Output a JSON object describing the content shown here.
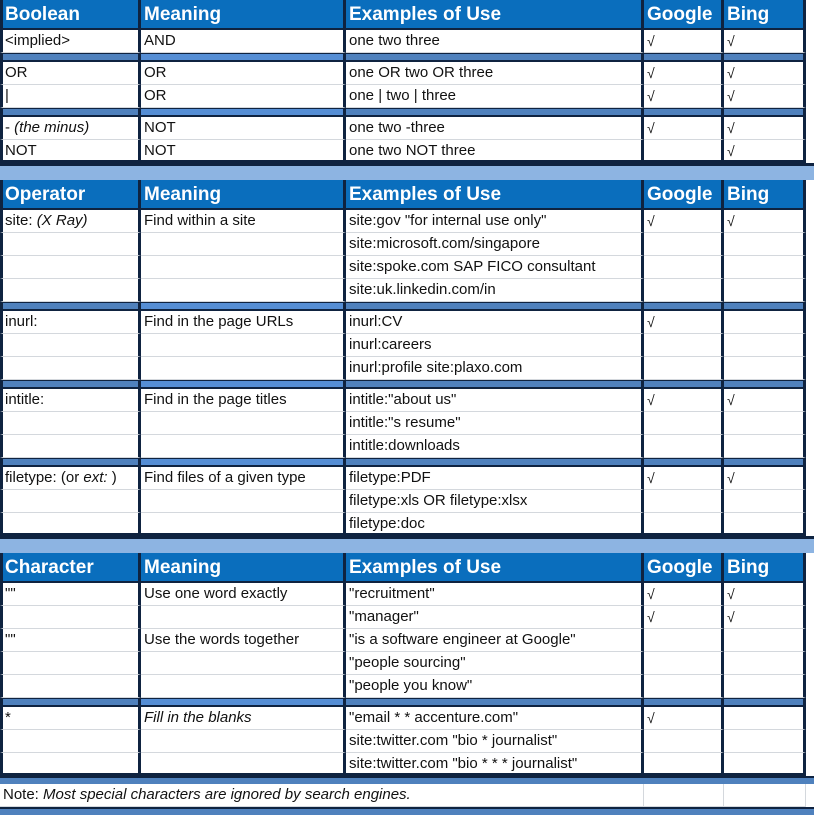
{
  "sections": [
    {
      "id": "boolean",
      "headers": [
        "Boolean",
        "Meaning",
        "Examples of Use",
        "Google",
        "Bing"
      ],
      "groups": [
        {
          "rows": [
            {
              "op": "<implied>",
              "meaning": "AND",
              "example": "one two three",
              "google": "√",
              "bing": "√"
            }
          ]
        },
        {
          "rows": [
            {
              "op": "OR",
              "meaning": "OR",
              "example": "one OR two OR three",
              "google": "√",
              "bing": "√"
            },
            {
              "op": "|",
              "meaning": "OR",
              "example": "one | two | three",
              "google": "√",
              "bing": "√"
            }
          ]
        },
        {
          "rows": [
            {
              "op": " - ",
              "op_italic": "(the minus)",
              "meaning": "NOT",
              "example": "one two -three",
              "google": "√",
              "bing": "√"
            },
            {
              "op": "NOT",
              "meaning": "NOT",
              "example": "one two NOT three",
              "google": "",
              "bing": "√"
            }
          ]
        }
      ]
    },
    {
      "id": "operator",
      "headers": [
        "Operator",
        "Meaning",
        "Examples of Use",
        "Google",
        "Bing"
      ],
      "groups": [
        {
          "rows": [
            {
              "op": "site: ",
              "op_italic": "(X Ray)",
              "meaning": "Find within a site",
              "example": "site:gov \"for internal use only\"",
              "google": "√",
              "bing": "√"
            },
            {
              "op": "",
              "meaning": "",
              "example": "site:microsoft.com/singapore",
              "google": "",
              "bing": ""
            },
            {
              "op": "",
              "meaning": "",
              "example": "site:spoke.com SAP FICO consultant",
              "google": "",
              "bing": ""
            },
            {
              "op": "",
              "meaning": "",
              "example": "site:uk.linkedin.com/in",
              "google": "",
              "bing": ""
            }
          ]
        },
        {
          "rows": [
            {
              "op": "inurl:",
              "meaning": "Find in the page URLs",
              "example": "inurl:CV",
              "google": "√",
              "bing": ""
            },
            {
              "op": "",
              "meaning": "",
              "example": "inurl:careers",
              "google": "",
              "bing": ""
            },
            {
              "op": "",
              "meaning": "",
              "example": "inurl:profile site:plaxo.com",
              "google": "",
              "bing": ""
            }
          ]
        },
        {
          "rows": [
            {
              "op": "intitle:",
              "meaning": "Find in the page titles",
              "example": "intitle:\"about us\"",
              "google": "√",
              "bing": "√"
            },
            {
              "op": "",
              "meaning": "",
              "example": "intitle:\"s resume\"",
              "google": "",
              "bing": ""
            },
            {
              "op": "",
              "meaning": "",
              "example": "intitle:downloads",
              "google": "",
              "bing": ""
            }
          ]
        },
        {
          "rows": [
            {
              "op": "filetype: (or ",
              "op_italic": "ext:",
              "op_after": " )",
              "meaning": "Find files of a given type",
              "example": "filetype:PDF",
              "google": "√",
              "bing": "√"
            },
            {
              "op": "",
              "meaning": "",
              "example": "filetype:xls OR filetype:xlsx",
              "google": "",
              "bing": ""
            },
            {
              "op": "",
              "meaning": "",
              "example": "filetype:doc",
              "google": "",
              "bing": ""
            }
          ]
        }
      ]
    },
    {
      "id": "character",
      "headers": [
        "Character",
        "Meaning",
        "Examples of Use",
        "Google",
        "Bing"
      ],
      "groups": [
        {
          "rows": [
            {
              "op": "\"\"",
              "meaning": "Use one word exactly",
              "example": "\"recruitment\"",
              "google": "√",
              "bing": "√"
            },
            {
              "op": "",
              "meaning": "",
              "example": "\"manager\"",
              "google": "√",
              "bing": "√"
            },
            {
              "op": "\"\"",
              "meaning": "Use the words together",
              "example": "\"is a software engineer at Google\"",
              "google": "",
              "bing": ""
            },
            {
              "op": "",
              "meaning": "",
              "example": "\"people sourcing\"",
              "google": "",
              "bing": ""
            },
            {
              "op": "",
              "meaning": "",
              "example": "\"people you know\"",
              "google": "",
              "bing": ""
            }
          ]
        },
        {
          "rows": [
            {
              "op": "*",
              "meaning": "",
              "meaning_italic": "Fill in the blanks",
              "example": "\"email * * accenture.com\"",
              "google": "√",
              "bing": ""
            },
            {
              "op": "",
              "meaning": "",
              "example": "site:twitter.com \"bio * journalist\"",
              "google": "",
              "bing": ""
            },
            {
              "op": "",
              "meaning": "",
              "example": "site:twitter.com \"bio * * * journalist\"",
              "google": "",
              "bing": ""
            }
          ]
        }
      ]
    }
  ],
  "note": {
    "label": "Note: ",
    "text": "Most special characters are ignored by search engines."
  },
  "colors": {
    "header_bg": "#0a6ebd",
    "separator": "#4f81bd",
    "gap": "#8db4e2",
    "border": "#0f2340"
  }
}
